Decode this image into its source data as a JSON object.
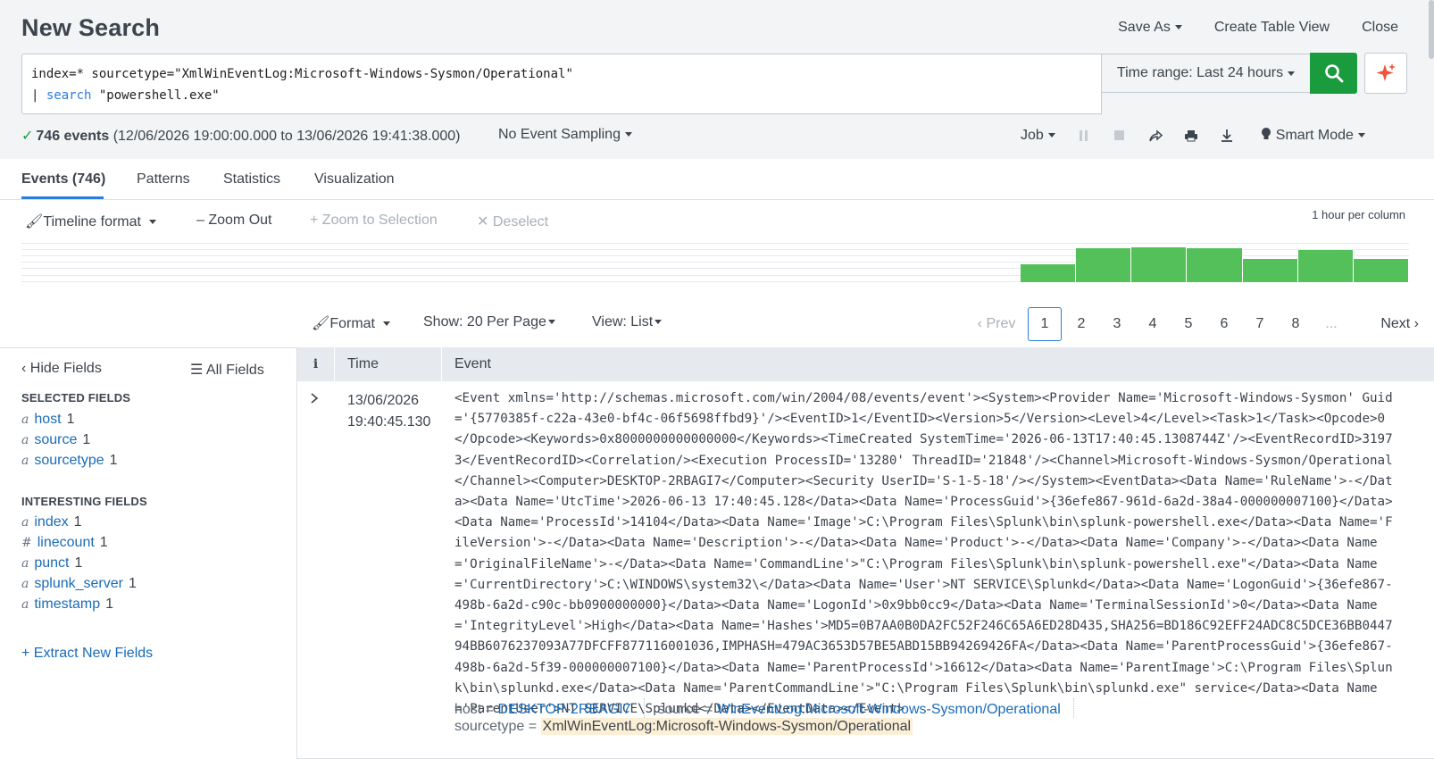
{
  "header": {
    "title": "New Search",
    "save_as": "Save As",
    "create_table_view": "Create Table View",
    "close": "Close"
  },
  "search": {
    "line1": "index=* sourcetype=\"XmlWinEventLog:Microsoft-Windows-Sysmon/Operational\"",
    "line2_pipe": "| ",
    "line2_cmd": "search",
    "line2_arg": " \"powershell.exe\"",
    "time_range": "Time range: Last 24 hours"
  },
  "status": {
    "count": "746 events",
    "range": "(12/06/2026 19:00:00.000 to 13/06/2026 19:41:38.000)",
    "sampling": "No Event Sampling",
    "job": "Job",
    "mode": "Smart Mode"
  },
  "tabs": [
    "Events (746)",
    "Patterns",
    "Statistics",
    "Visualization"
  ],
  "timeline": {
    "format": "Timeline format",
    "zoom_out": "Zoom Out",
    "zoom_selection": "Zoom to Selection",
    "deselect": "Deselect",
    "per_column": "1 hour per column",
    "bar_counts": [
      30,
      58,
      60,
      58,
      40,
      55,
      40
    ]
  },
  "results_bar": {
    "format": "Format",
    "show": "Show: 20 Per Page",
    "view": "View: List",
    "prev": "Prev",
    "pages": [
      "1",
      "2",
      "3",
      "4",
      "5",
      "6",
      "7",
      "8"
    ],
    "ellipsis": "...",
    "next": "Next",
    "current_page": "1"
  },
  "sidebar": {
    "hide_fields": "Hide Fields",
    "all_fields": "All Fields",
    "selected_title": "SELECTED FIELDS",
    "selected": [
      {
        "type": "a",
        "name": "host",
        "count": "1"
      },
      {
        "type": "a",
        "name": "source",
        "count": "1"
      },
      {
        "type": "a",
        "name": "sourcetype",
        "count": "1"
      }
    ],
    "interesting_title": "INTERESTING FIELDS",
    "interesting": [
      {
        "type": "a",
        "name": "index",
        "count": "1"
      },
      {
        "type": "#",
        "name": "linecount",
        "count": "1"
      },
      {
        "type": "a",
        "name": "punct",
        "count": "1"
      },
      {
        "type": "a",
        "name": "splunk_server",
        "count": "1"
      },
      {
        "type": "a",
        "name": "timestamp",
        "count": "1"
      }
    ],
    "extract": "+ Extract New Fields"
  },
  "table": {
    "col_i": "i",
    "col_time": "Time",
    "col_event": "Event"
  },
  "event": {
    "date": "13/06/2026",
    "time": "19:40:45.130",
    "raw": "<Event xmlns='http://schemas.microsoft.com/win/2004/08/events/event'><System><Provider Name='Microsoft-Windows-Sysmon' Guid='{5770385f-c22a-43e0-bf4c-06f5698ffbd9}'/><EventID>1</EventID><Version>5</Version><Level>4</Level><Task>1</Task><Opcode>0</Opcode><Keywords>0x8000000000000000</Keywords><TimeCreated SystemTime='2026-06-13T17:40:45.1308744Z'/><EventRecordID>31973</EventRecordID><Correlation/><Execution ProcessID='13280' ThreadID='21848'/><Channel>Microsoft-Windows-Sysmon/Operational</Channel><Computer>DESKTOP-2RBAGI7</Computer><Security UserID='S-1-5-18'/></System><EventData><Data Name='RuleName'>-</Data><Data Name='UtcTime'>2026-06-13 17:40:45.128</Data><Data Name='ProcessGuid'>{36efe867-961d-6a2d-38a4-000000007100}</Data><Data Name='ProcessId'>14104</Data><Data Name='Image'>C:\\Program Files\\Splunk\\bin\\splunk-powershell.exe</Data><Data Name='FileVersion'>-</Data><Data Name='Description'>-</Data><Data Name='Product'>-</Data><Data Name='Company'>-</Data><Data Name='OriginalFileName'>-</Data><Data Name='CommandLine'>\"C:\\Program Files\\Splunk\\bin\\splunk-powershell.exe\"</Data><Data Name='CurrentDirectory'>C:\\WINDOWS\\system32\\</Data><Data Name='User'>NT SERVICE\\Splunkd</Data><Data Name='LogonGuid'>{36efe867-498b-6a2d-c90c-bb0900000000}</Data><Data Name='LogonId'>0x9bb0cc9</Data><Data Name='TerminalSessionId'>0</Data><Data Name='IntegrityLevel'>High</Data><Data Name='Hashes'>MD5=0B7AA0B0DA2FC52F246C65A6ED28D435,SHA256=BD186C92EFF24ADC8C5DCE36BB044794BB6076237093A77DFCFF877116001036,IMPHASH=479AC3653D57BE5ABD15BB94269426FA</Data><Data Name='ParentProcessGuid'>{36efe867-498b-6a2d-5f39-000000007100}</Data><Data Name='ParentProcessId'>16612</Data><Data Name='ParentImage'>C:\\Program Files\\Splunk\\bin\\splunkd.exe</Data><Data Name='ParentCommandLine'>\"C:\\Program Files\\Splunk\\bin\\splunkd.exe\" service</Data><Data Name='ParentUser'>NT SERVICE\\Splunkd</Data></EventData></Event>",
    "host_label": "host =",
    "host": "DESKTOP-2RBAGI7",
    "source_label": "source =",
    "source": "WinEventLog:Microsoft-Windows-Sysmon/Operational",
    "sourcetype_label": "sourcetype =",
    "sourcetype": "XmlWinEventLog:Microsoft-Windows-Sysmon/Operational"
  },
  "colors": {
    "accent": "#2a7ce0",
    "search_button": "#1a9c3e",
    "timeline_bar": "#53c05a",
    "highlight": "#fcefd5"
  }
}
